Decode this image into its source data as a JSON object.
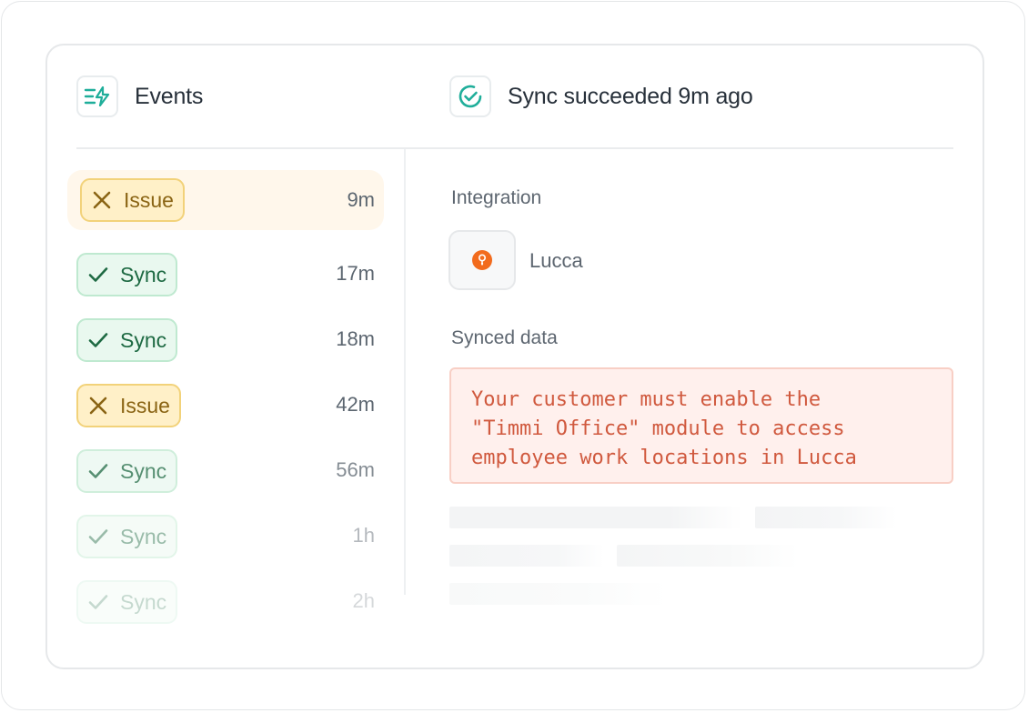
{
  "events_panel": {
    "title": "Events",
    "icon": "lightning-list-icon"
  },
  "status_panel": {
    "title": "Sync succeeded 9m ago",
    "icon": "check-circle-icon"
  },
  "events": [
    {
      "type": "issue",
      "label": "Issue",
      "time": "9m",
      "selected": true
    },
    {
      "type": "sync",
      "label": "Sync",
      "time": "17m"
    },
    {
      "type": "sync",
      "label": "Sync",
      "time": "18m"
    },
    {
      "type": "issue",
      "label": "Issue",
      "time": "42m"
    },
    {
      "type": "sync",
      "label": "Sync",
      "time": "56m"
    },
    {
      "type": "sync",
      "label": "Sync",
      "time": "1h"
    },
    {
      "type": "sync",
      "label": "Sync",
      "time": "2h"
    }
  ],
  "detail": {
    "integration_label": "Integration",
    "integration_name": "Lucca",
    "integration_logo_color": "#f26b1d",
    "synced_data_label": "Synced data",
    "error_message": "Your customer must enable the\n\"Timmi Office\" module to access\nemployee work locations in Lucca"
  },
  "colors": {
    "sync_pill_bg": "#e9f8ef",
    "issue_pill_bg": "#fff0c8",
    "error_text": "#d0593e",
    "accent": "#1fae9a"
  }
}
